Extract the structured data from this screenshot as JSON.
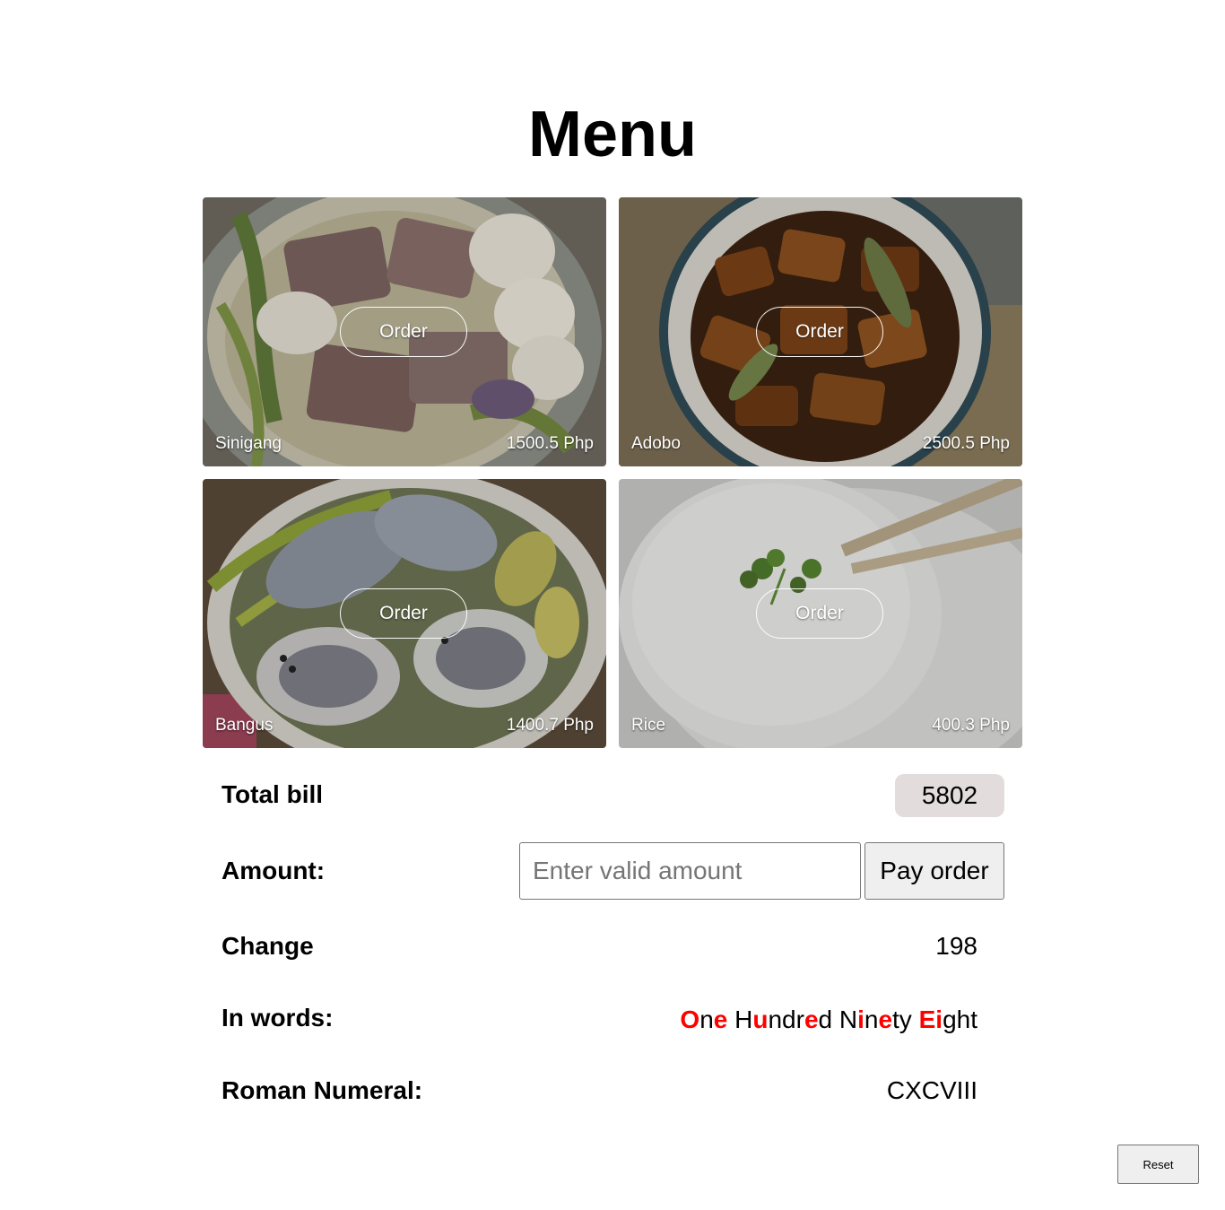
{
  "header": {
    "title": "Menu"
  },
  "menu": {
    "items": [
      {
        "name": "Sinigang",
        "price": "1500.5 Php",
        "order_label": "Order"
      },
      {
        "name": "Adobo",
        "price": "2500.5 Php",
        "order_label": "Order"
      },
      {
        "name": "Bangus",
        "price": "1400.7 Php",
        "order_label": "Order"
      },
      {
        "name": "Rice",
        "price": "400.3 Php",
        "order_label": "Order"
      }
    ]
  },
  "bill": {
    "total_label": "Total bill",
    "total_value": "5802",
    "amount_label": "Amount:",
    "amount_placeholder": "Enter valid amount",
    "amount_value": "",
    "pay_label": "Pay order",
    "change_label": "Change",
    "change_value": "198",
    "words_label": "In words:",
    "words_segments": [
      {
        "text": "O",
        "highlight": true
      },
      {
        "text": "n",
        "highlight": false
      },
      {
        "text": "e",
        "highlight": true
      },
      {
        "text": " H",
        "highlight": false
      },
      {
        "text": "u",
        "highlight": true
      },
      {
        "text": "ndr",
        "highlight": false
      },
      {
        "text": "e",
        "highlight": true
      },
      {
        "text": "d N",
        "highlight": false
      },
      {
        "text": "i",
        "highlight": true
      },
      {
        "text": "n",
        "highlight": false
      },
      {
        "text": "e",
        "highlight": true
      },
      {
        "text": "ty ",
        "highlight": false
      },
      {
        "text": "Ei",
        "highlight": true
      },
      {
        "text": "ght",
        "highlight": false
      }
    ],
    "roman_label": "Roman Numeral:",
    "roman_value": "CXCVIII"
  },
  "actions": {
    "reset_label": "Reset"
  },
  "colors": {
    "vowel_highlight": "#ff0000",
    "total_pill_bg": "#e2dcdc"
  },
  "icons": {
    "food_photos": [
      "sinigang-soup-photo",
      "adobo-pork-photo",
      "bangus-fish-photo",
      "rice-bowl-photo"
    ]
  }
}
